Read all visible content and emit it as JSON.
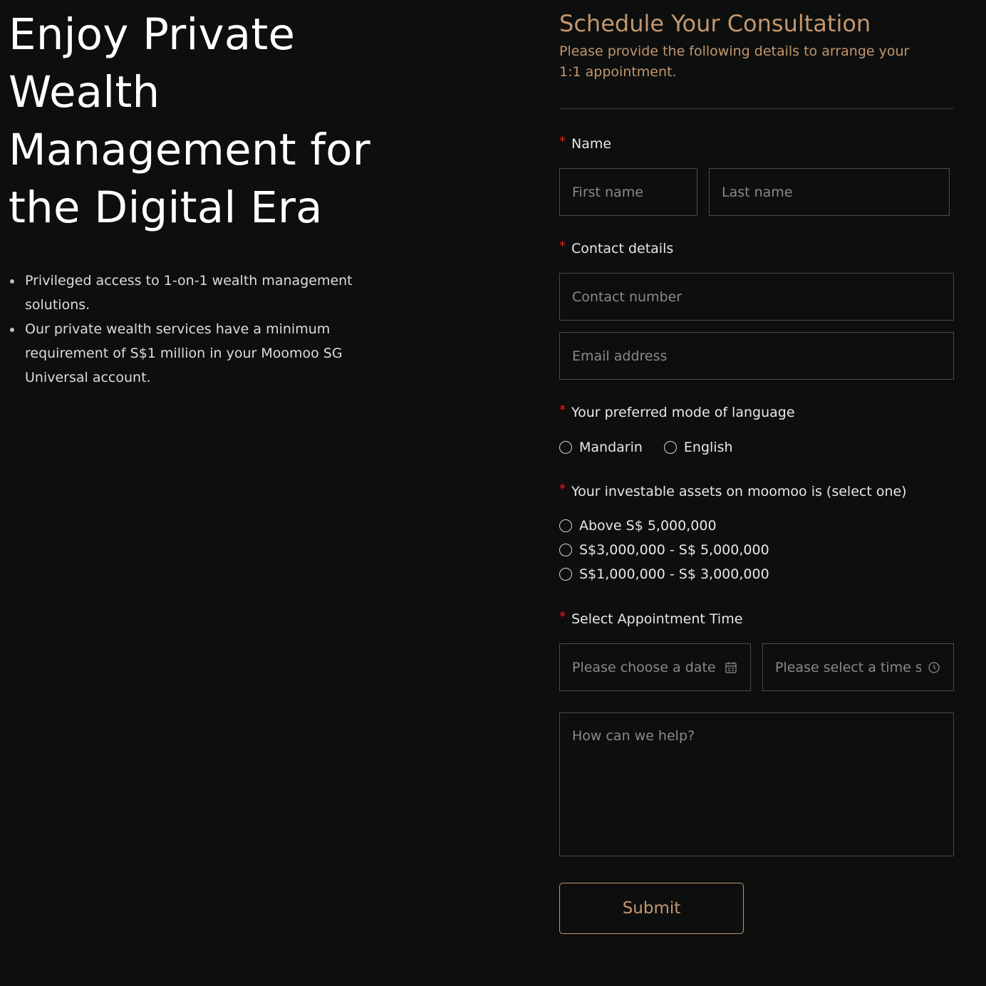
{
  "hero": {
    "title_lines": [
      "Enjoy Private",
      "Wealth",
      "Management for",
      "the Digital Era"
    ],
    "benefits": [
      "Privileged access to 1-on-1 wealth management solutions.",
      "Our private wealth services have a minimum requirement of S$1 million in your Moomoo SG Universal account."
    ]
  },
  "form": {
    "title": "Schedule Your Consultation",
    "subtitle": "Please provide the following details to arrange your 1:1 appointment.",
    "required_mark": "*",
    "name": {
      "label": "Name",
      "first_placeholder": "First name",
      "last_placeholder": "Last name"
    },
    "contact": {
      "label": "Contact details",
      "phone_placeholder": "Contact number",
      "email_placeholder": "Email address"
    },
    "language": {
      "label": "Your preferred mode of language",
      "options": [
        "Mandarin",
        "English"
      ]
    },
    "assets": {
      "label": "Your investable assets on moomoo is (select one)",
      "options": [
        "Above S$ 5,000,000",
        "S$3,000,000 - S$ 5,000,000",
        "S$1,000,000 - S$ 3,000,000"
      ]
    },
    "appointment": {
      "label": "Select Appointment Time",
      "date_placeholder": "Please choose a date",
      "time_placeholder": "Please select a time s",
      "date_icon": "calendar-icon",
      "time_icon": "clock-icon"
    },
    "message_placeholder": "How can we help?",
    "submit_label": "Submit"
  },
  "colors": {
    "background": "#0d0e0e",
    "accent": "#c3976c",
    "required": "#e02424"
  }
}
